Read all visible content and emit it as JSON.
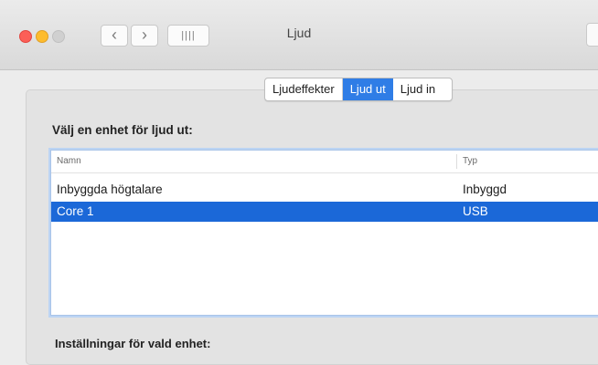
{
  "window": {
    "title": "Ljud",
    "grid_icon_glyph": "||||"
  },
  "toolbar": {
    "back_glyph": "‹",
    "forward_glyph": "›"
  },
  "tabs": [
    {
      "label": "Ljudeffekter",
      "active": false
    },
    {
      "label": "Ljud ut",
      "active": true
    },
    {
      "label": "Ljud in",
      "active": false
    }
  ],
  "output": {
    "section_label": "Välj en enhet för ljud ut:",
    "columns": {
      "name": "Namn",
      "type": "Typ"
    },
    "devices": [
      {
        "name": "Inbyggda högtalare",
        "type": "Inbyggd",
        "selected": false
      },
      {
        "name": "Core 1",
        "type": "USB",
        "selected": true
      }
    ]
  },
  "settings_label": "Inställningar för vald enhet:",
  "colors": {
    "accent": "#2f7de6",
    "selection": "#1b68d8",
    "close": "#fc5f57",
    "minimize": "#fdbc2e"
  }
}
